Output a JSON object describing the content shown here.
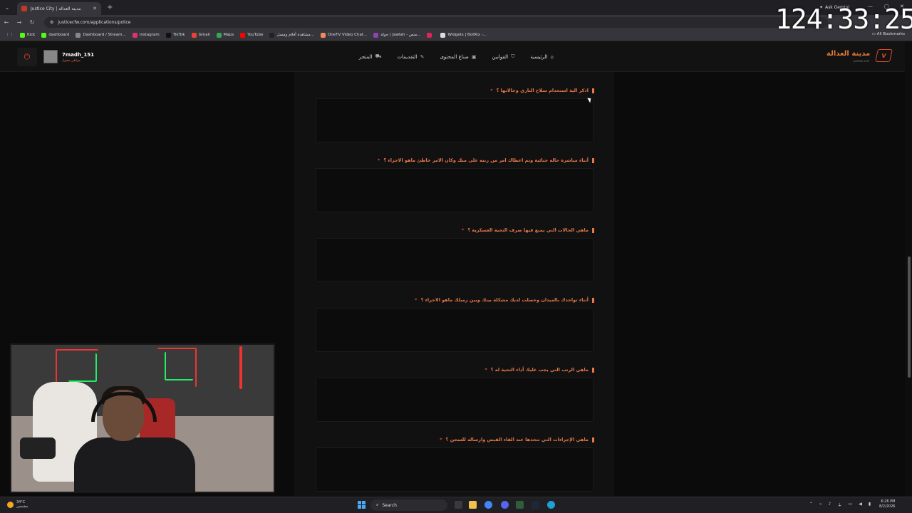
{
  "browser": {
    "tab_title": "Justice City | مدينة العدالة",
    "new_tab_icon": "+",
    "url": "justicecfw.com/applications/police",
    "ask_gemini": "Ask Gemini",
    "all_bookmarks": "All Bookmarks",
    "bookmarks": [
      {
        "label": "Kick",
        "color": "#53fc18"
      },
      {
        "label": "dashboard",
        "color": "#53fc18"
      },
      {
        "label": "Dashboard / Stream...",
        "color": "#888888"
      },
      {
        "label": "instagram",
        "color": "#e1306c"
      },
      {
        "label": "TikTok",
        "color": "#111111"
      },
      {
        "label": "Gmail",
        "color": "#ea4335"
      },
      {
        "label": "Maps",
        "color": "#34a853"
      },
      {
        "label": "YouTube",
        "color": "#ff0000"
      },
      {
        "label": "مشاهدة أفلام ومسل...",
        "color": "#222222"
      },
      {
        "label": "OneTV Video Chat...",
        "color": "#f08a5d"
      },
      {
        "label": "جولة | Jawlah - منص...",
        "color": "#8e44ad"
      },
      {
        "label": "",
        "color": "#e0245e"
      },
      {
        "label": "Widgets | BotRix -...",
        "color": "#dddddd"
      }
    ]
  },
  "overlay": {
    "timer": "124:33:25"
  },
  "site": {
    "username": "7madh_151",
    "user_status": "مواطن مقبول",
    "brand": "مدينة العدالة",
    "brand_sub": "JUSTICE CITY",
    "brand_logo": "V",
    "nav": [
      {
        "label": "الرئيسية",
        "icon": "⌂"
      },
      {
        "label": "القوانين",
        "icon": "⛉"
      },
      {
        "label": "صناع المحتوى",
        "icon": "▣"
      },
      {
        "label": "التقديمات",
        "icon": "✎"
      },
      {
        "label": "المتجر",
        "icon": "⛟"
      }
    ],
    "logout_icon": "⏻"
  },
  "questions": [
    {
      "text": "اذكر الية استخدام سلاح الناري وحالاتها ؟",
      "required": "*"
    },
    {
      "text": "أثناء مباشرة حاله جنائية وتم اعطاك امر من رتبه على منك وكان الامر خاطئ ماهو الاجراء ؟",
      "required": "*"
    },
    {
      "text": "ماهي الحالات التي يمنع فيها صرف التحية العسكرية ؟",
      "required": "*"
    },
    {
      "text": "أثناء تواجدك بالميدان وحصلت لديك مشكلة بينك وبين زميلك ماهو الاجراء ؟",
      "required": "*"
    },
    {
      "text": "ماهي الرتب التي يجب عليك أداء التحية له ؟",
      "required": "*"
    },
    {
      "text": "ماهي الإجراءات التي تتخذها عند القاء القبض وارساله للسجن ؟",
      "required": "*"
    }
  ],
  "taskbar": {
    "weather_temp": "34°C",
    "weather_desc": "مشمس",
    "search_placeholder": "Search",
    "time": "6:26 PM",
    "date": "8/2/2026"
  }
}
